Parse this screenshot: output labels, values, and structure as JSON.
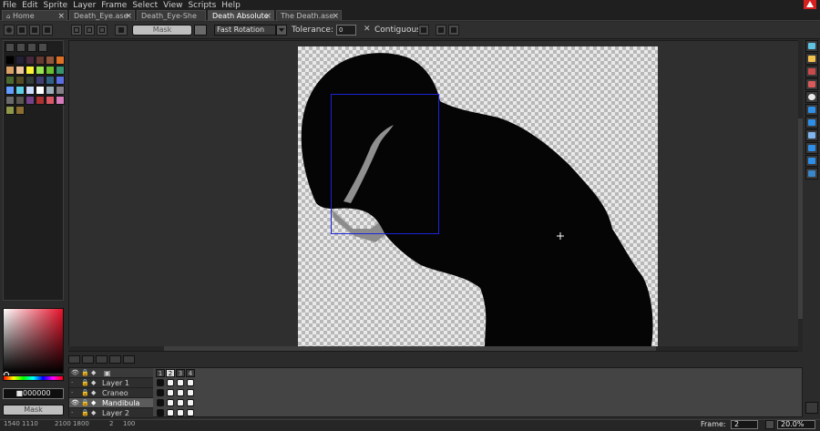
{
  "menu": [
    "File",
    "Edit",
    "Sprite",
    "Layer",
    "Frame",
    "Select",
    "View",
    "Scripts",
    "Help"
  ],
  "tabs": [
    {
      "label": "Home",
      "active": false
    },
    {
      "label": "Death_Eye.ase",
      "active": false
    },
    {
      "label": "Death_Eye-She",
      "active": false
    },
    {
      "label": "Death Absolute",
      "active": true
    },
    {
      "label": "The Death.ase",
      "active": false
    }
  ],
  "toolbar": {
    "mask_label": "Mask",
    "rotation_algorithm": "Fast Rotation",
    "tolerance_label": "Tolerance:",
    "tolerance_value": "0",
    "contiguous_label": "Contiguous",
    "contiguous_checked": true
  },
  "palette": {
    "colors": [
      "#000000",
      "#222034",
      "#45283c",
      "#663931",
      "#8f563b",
      "#df7126",
      "#d9a066",
      "#eec39a",
      "#fbf236",
      "#99e550",
      "#6abe30",
      "#37946e",
      "#4b692f",
      "#524b24",
      "#323c39",
      "#3f3f74",
      "#306082",
      "#5b6ee1",
      "#639bff",
      "#5fcde4",
      "#cbdbfc",
      "#ffffff",
      "#9badb7",
      "#847e87",
      "#696a6a",
      "#595652",
      "#76428a",
      "#ac3232",
      "#d95763",
      "#d77bba",
      "#8f974a",
      "#8a6f30"
    ]
  },
  "color": {
    "hex": "■000000",
    "mask_label": "Mask",
    "accent": "#e8122a"
  },
  "layers": [
    {
      "name": "Layer 1",
      "visible": false,
      "active": false,
      "cels": [
        1,
        1,
        1,
        1
      ]
    },
    {
      "name": "Craneo",
      "visible": false,
      "active": false,
      "cels": [
        1,
        1,
        1,
        1
      ]
    },
    {
      "name": "Mandibula",
      "visible": true,
      "active": true,
      "cels": [
        1,
        1,
        1,
        1
      ]
    },
    {
      "name": "Layer 2",
      "visible": false,
      "active": false,
      "cels": [
        1,
        1,
        1,
        1
      ]
    }
  ],
  "frames": [
    "1",
    "2",
    "3",
    "4"
  ],
  "status": {
    "position": "1540 1110",
    "size": "2100 1800",
    "frames_count": "2",
    "zoom_value": "100",
    "frame_label": "Frame:",
    "frame_value": "2",
    "zoom": "20.0%"
  },
  "icons": {
    "app_logo": "aseprite-logo",
    "canvas_cursor": "crosshair-icon"
  }
}
